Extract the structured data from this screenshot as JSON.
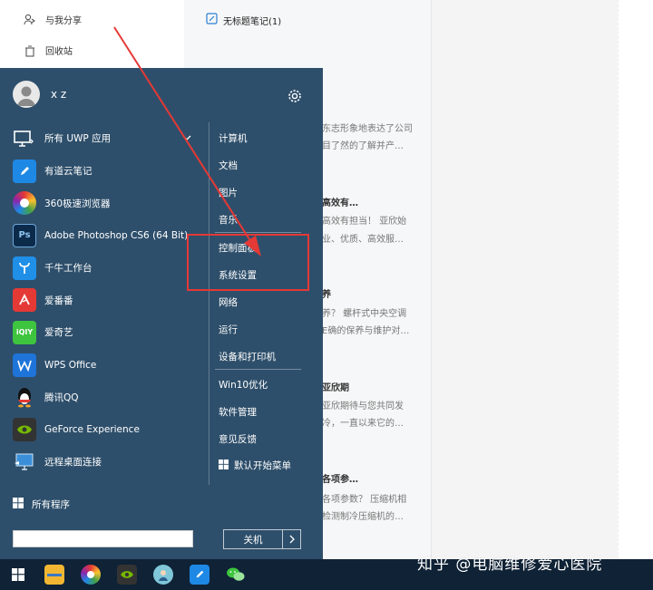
{
  "background_app": {
    "sidebar": {
      "items": [
        {
          "label": "与我分享",
          "icon": "share-user-icon"
        },
        {
          "label": "回收站",
          "icon": "trash-icon"
        }
      ]
    },
    "note_list": {
      "first_note_title": "无标题笔记(1)",
      "snippets": [
        "东志形象地表达了公司",
        "目了然的了解并产…",
        "高效有…",
        "高效有担当！ 亚欣始",
        "业、优质、高效服…",
        "养",
        "养？ 螺杆式中央空调",
        "E确的保养与维护对…",
        "亚欣期",
        "亚欣期待与您共同发",
        "冷，一直以来它的…",
        "各项参…",
        "各项参数？ 压缩机相",
        "检测制冷压缩机的…"
      ]
    }
  },
  "start_menu": {
    "user_name": "x z",
    "settings_icon": "gear-icon",
    "apps": [
      {
        "label": "所有 UWP 应用",
        "icon": "uwp-apps-icon",
        "color": "#2e4f6b"
      },
      {
        "label": "有道云笔记",
        "icon": "youdao-note-icon",
        "color": "#1e88e5"
      },
      {
        "label": "360极速浏览器",
        "icon": "browser-360-icon",
        "color": "#f4a32b"
      },
      {
        "label": "Adobe Photoshop CS6 (64 Bit)",
        "icon": "photoshop-icon",
        "color": "#0c2b4b"
      },
      {
        "label": "千牛工作台",
        "icon": "qianniu-icon",
        "color": "#1f8fe8"
      },
      {
        "label": "爱番番",
        "icon": "aifanfan-icon",
        "color": "#e53935"
      },
      {
        "label": "爱奇艺",
        "icon": "iqiyi-icon",
        "color": "#3ec43e"
      },
      {
        "label": "WPS Office",
        "icon": "wps-icon",
        "color": "#1e74d9"
      },
      {
        "label": "腾讯QQ",
        "icon": "qq-penguin-icon",
        "color": "#2e4f6b"
      },
      {
        "label": "GeForce Experience",
        "icon": "geforce-icon",
        "color": "#5a5a5a"
      },
      {
        "label": "远程桌面连接",
        "icon": "remote-desktop-icon",
        "color": "#3a8fd8"
      }
    ],
    "all_programs": "所有程序",
    "right_items": [
      "计算机",
      "文档",
      "图片",
      "音乐",
      "控制面板",
      "系统设置",
      "网络",
      "运行",
      "设备和打印机",
      "Win10优化",
      "软件管理",
      "意见反馈",
      "默认开始菜单"
    ],
    "search_placeholder": "",
    "power_label": "关机"
  },
  "taskbar": {
    "icons": [
      "windows-start-icon",
      "file-explorer-icon",
      "browser-360-icon",
      "nvidia-icon",
      "user-avatar-app-icon",
      "youdao-note-icon",
      "wechat-icon"
    ]
  },
  "colors": {
    "start_bg": "#2e4f6b",
    "taskbar_bg": "#0f2236",
    "highlight": "#e53935"
  },
  "watermark": "知乎 @电脑维修爱心医院"
}
